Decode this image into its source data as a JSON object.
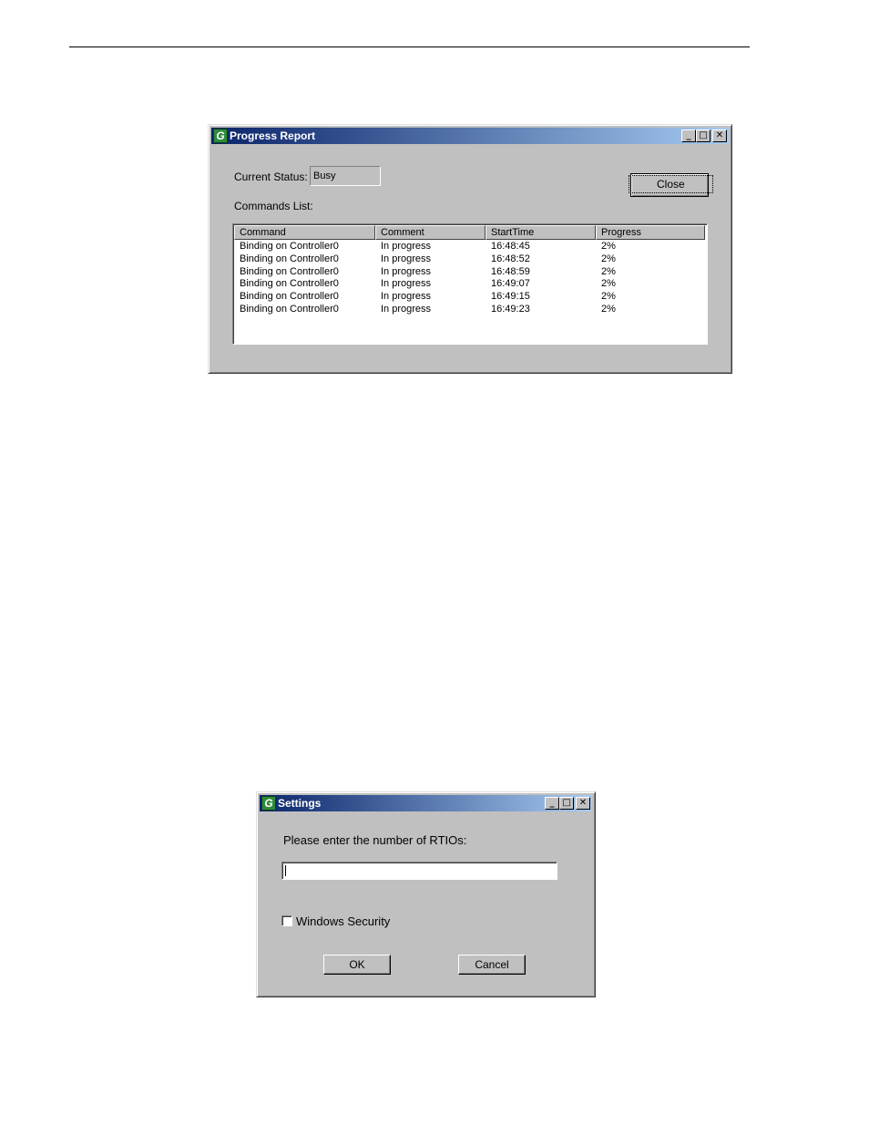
{
  "progress_report": {
    "title": "Progress Report",
    "current_status_label": "Current Status:",
    "current_status_value": "Busy",
    "commands_list_label": "Commands List:",
    "close_label": "Close",
    "columns": [
      "Command",
      "Comment",
      "StartTime",
      "Progress"
    ],
    "rows": [
      {
        "command": "Binding on Controller0",
        "comment": "In progress",
        "start": "16:48:45",
        "progress": "2%"
      },
      {
        "command": "Binding on Controller0",
        "comment": "In progress",
        "start": "16:48:52",
        "progress": "2%"
      },
      {
        "command": "Binding on Controller0",
        "comment": "In progress",
        "start": "16:48:59",
        "progress": "2%"
      },
      {
        "command": "Binding on Controller0",
        "comment": "In progress",
        "start": "16:49:07",
        "progress": "2%"
      },
      {
        "command": "Binding on Controller0",
        "comment": "In progress",
        "start": "16:49:15",
        "progress": "2%"
      },
      {
        "command": "Binding on Controller0",
        "comment": "In progress",
        "start": "16:49:23",
        "progress": "2%"
      }
    ]
  },
  "settings": {
    "title": "Settings",
    "prompt": "Please enter the number of RTIOs:",
    "rtio_value": "",
    "checkbox_label": "Windows Security",
    "checkbox_checked": false,
    "ok_label": "OK",
    "cancel_label": "Cancel"
  },
  "titlebar_buttons": {
    "minimize": "_",
    "maximize": "□",
    "close": "✕"
  },
  "app_icon_letter": "G",
  "colors": {
    "titlebar_start": "#0a246a",
    "titlebar_end": "#a6caf0",
    "window_bg": "#c0c0c0"
  }
}
